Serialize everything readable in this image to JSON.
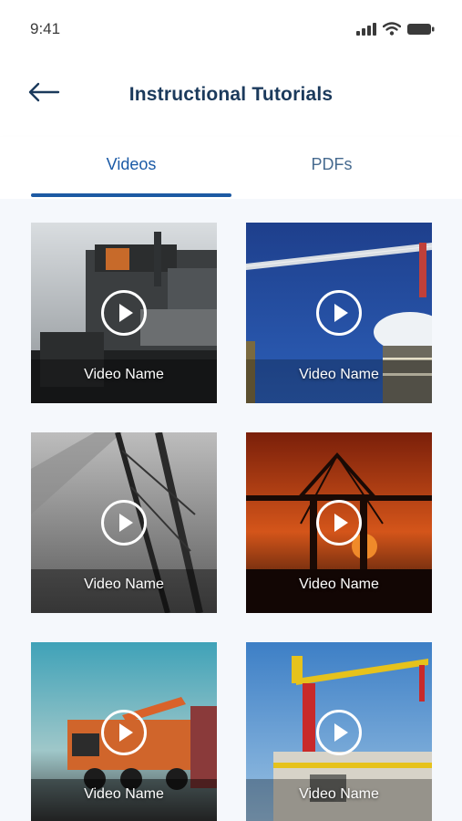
{
  "status": {
    "time": "9:41",
    "icons": [
      "cellular-signal-icon",
      "wifi-icon",
      "battery-icon"
    ]
  },
  "header": {
    "back_icon": "arrow-left-icon",
    "title": "Instructional Tutorials"
  },
  "tabs": [
    {
      "label": "Videos",
      "active": true
    },
    {
      "label": "PDFs",
      "active": false
    }
  ],
  "colors": {
    "title": "#1b3a5c",
    "accent": "#1d5aa3",
    "inactive_tab": "#466a8f",
    "content_bg": "#f5f8fc"
  },
  "videos": [
    {
      "label": "Video Name",
      "thumbnail": "excavator close-up"
    },
    {
      "label": "Video Name",
      "thumbnail": "tower crane against blue sky"
    },
    {
      "label": "Video Name",
      "thumbnail": "black and white crane"
    },
    {
      "label": "Video Name",
      "thumbnail": "port cranes at sunset"
    },
    {
      "label": "Video Name",
      "thumbnail": "mobile crane truck"
    },
    {
      "label": "Video Name",
      "thumbnail": "yellow tower crane on site"
    }
  ],
  "play_icon": "play-circle-icon"
}
